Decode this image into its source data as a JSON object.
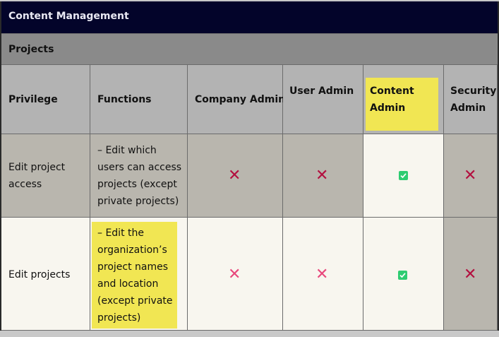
{
  "section_title": "Content Management",
  "subsection_title": "Projects",
  "columns": {
    "privilege": "Privilege",
    "functions": "Functions",
    "company_admin": "Company Admin",
    "user_admin": "User Admin",
    "content_admin_line1": "Content",
    "content_admin_line2": "Admin",
    "security_admin_line1": "Security",
    "security_admin_line2": "Admin"
  },
  "rows": [
    {
      "privilege_line1": "Edit project",
      "privilege_line2": "access",
      "functions_lines": [
        "– Edit which",
        "users can access",
        "projects (except",
        "private projects)"
      ],
      "company_admin": "✕",
      "user_admin": "✕",
      "content_admin": "check",
      "security_admin": "✕"
    },
    {
      "privilege_line1": "Edit projects",
      "functions_lines": [
        "– Edit the",
        "organization’s",
        "project names",
        "and location",
        "(except private",
        "projects)"
      ],
      "company_admin": "✕",
      "user_admin": "✕",
      "content_admin": "check",
      "security_admin": "✕"
    }
  ],
  "colors": {
    "header_dark": "#03042a",
    "highlight": "#f1e653",
    "cross_dark": "#b30f3f",
    "cross_pink": "#e8487c",
    "check_green": "#2ecc71"
  }
}
